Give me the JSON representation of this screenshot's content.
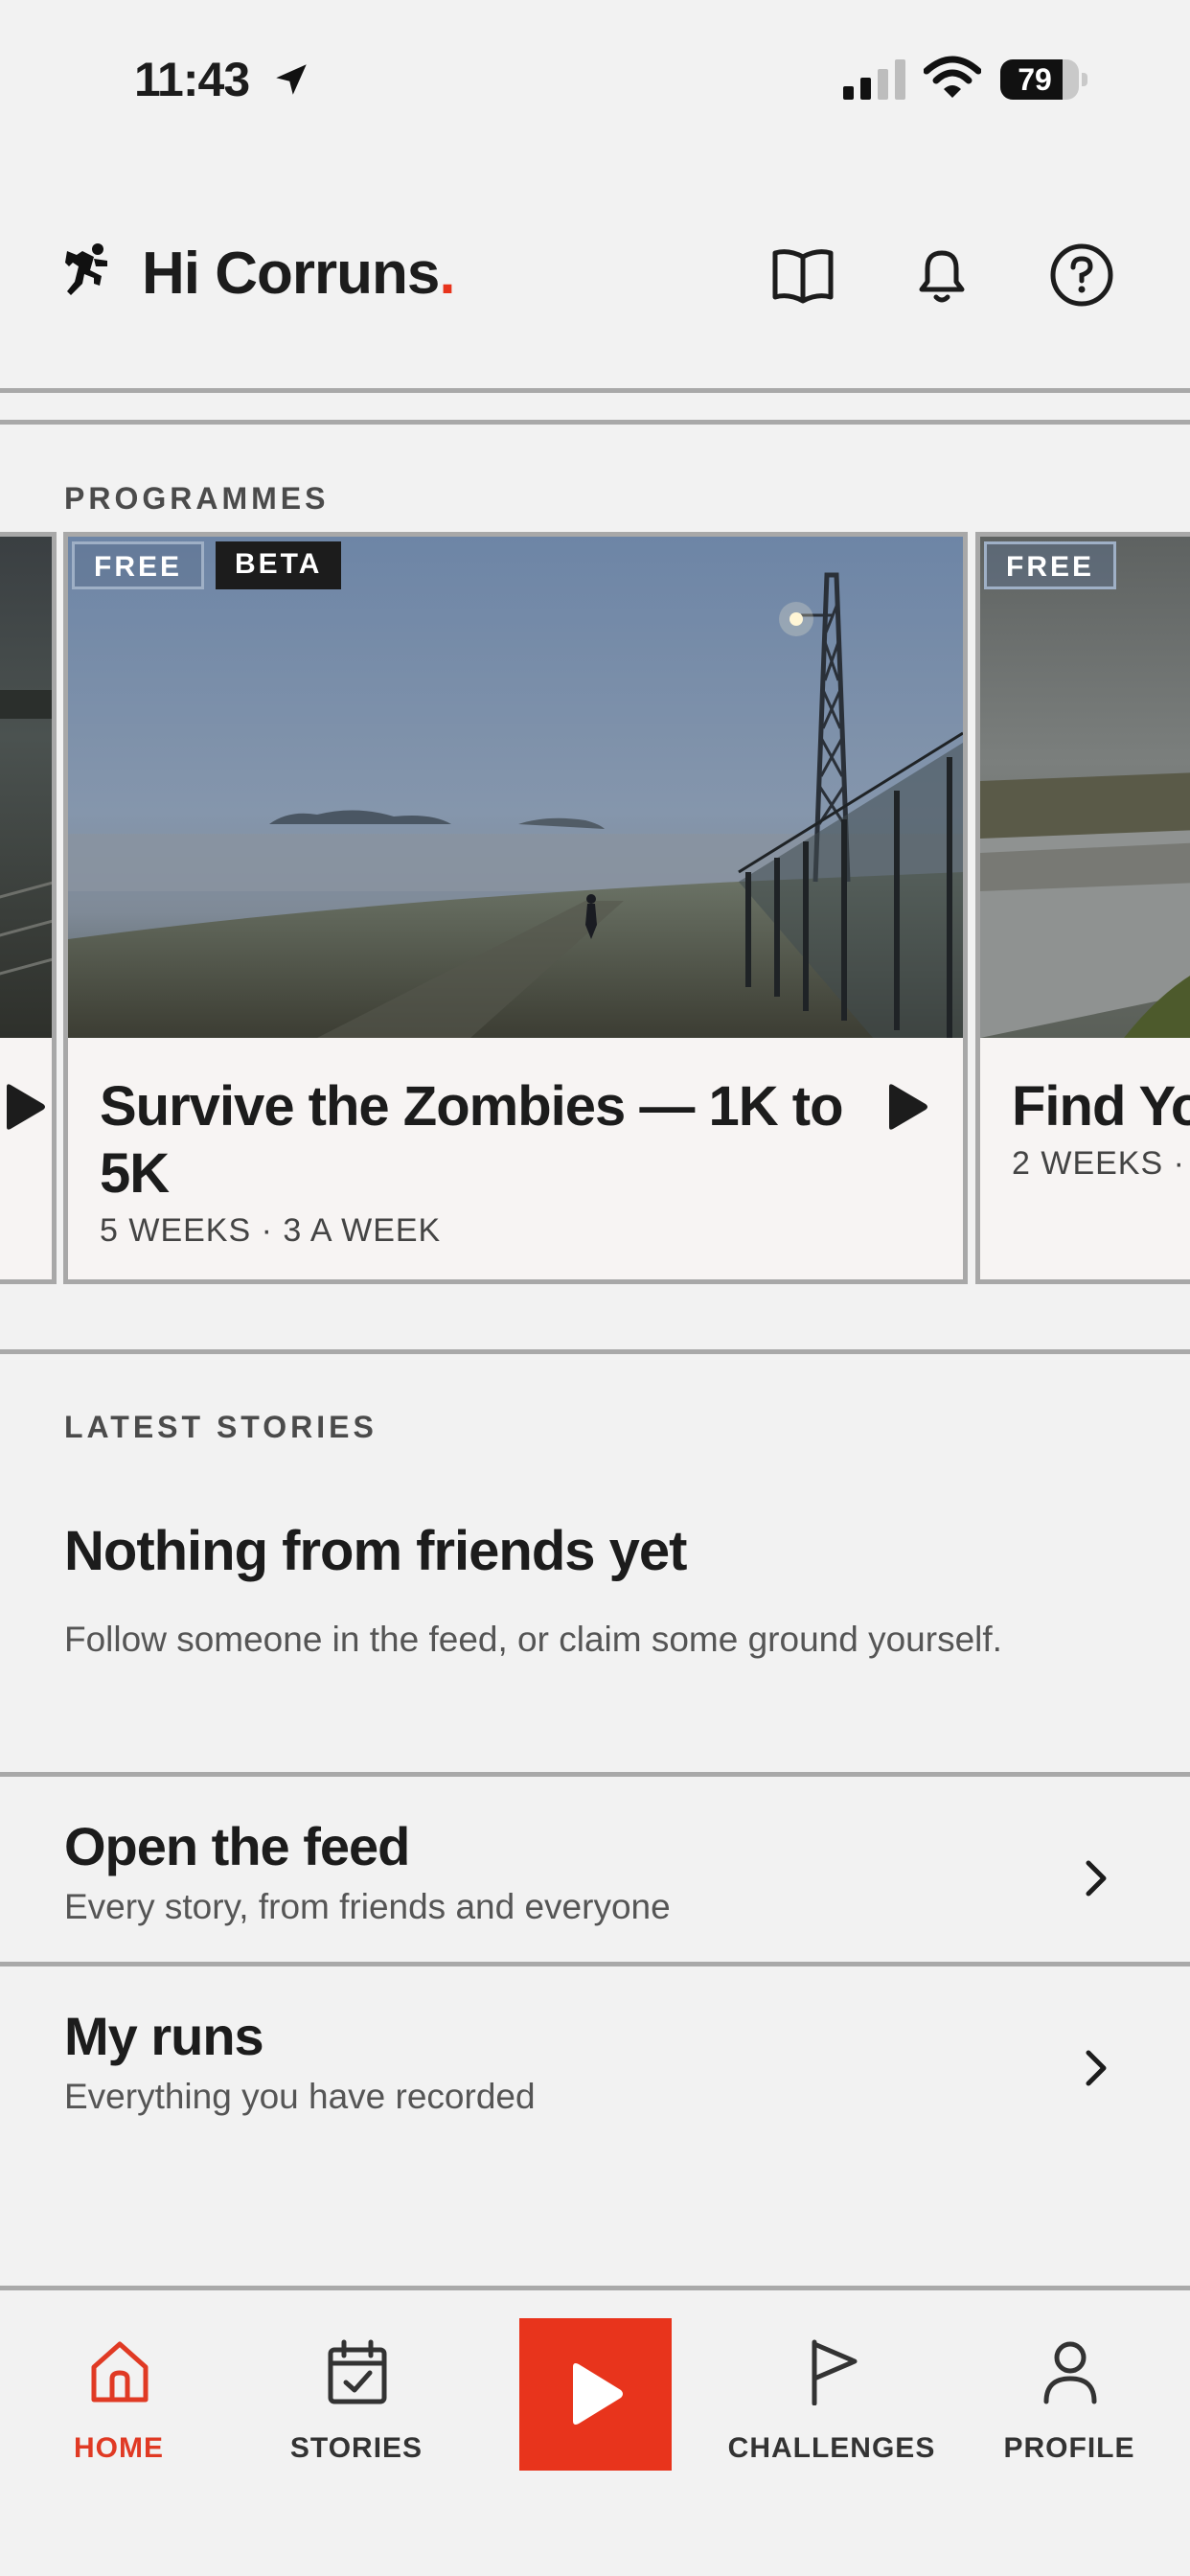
{
  "status_bar": {
    "time": "11:43",
    "battery": "79",
    "battery_level": 0.79
  },
  "header": {
    "greeting": "Hi Corruns",
    "greeting_dot": "."
  },
  "programmes": {
    "label": "PROGRAMMES",
    "cards": [
      {
        "badges": [
          "FREE",
          "BETA"
        ],
        "title": "Survive the Zombies — 1K to 5K",
        "meta": "5 WEEKS · 3 A WEEK"
      },
      {
        "badges": [
          "FREE"
        ],
        "title": "Find Yo",
        "meta": "2 WEEKS ·"
      }
    ]
  },
  "stories": {
    "label": "LATEST STORIES",
    "empty_title": "Nothing from friends yet",
    "empty_sub": "Follow someone in the feed, or claim some ground yourself."
  },
  "links": [
    {
      "title": "Open the feed",
      "sub": "Every story, from friends and everyone"
    },
    {
      "title": "My runs",
      "sub": "Everything you have recorded"
    }
  ],
  "tabbar": {
    "home": "HOME",
    "stories": "STORIES",
    "challenges": "CHALLENGES",
    "profile": "PROFILE",
    "active_color": "#e03a24",
    "accent": "#e8341c"
  }
}
